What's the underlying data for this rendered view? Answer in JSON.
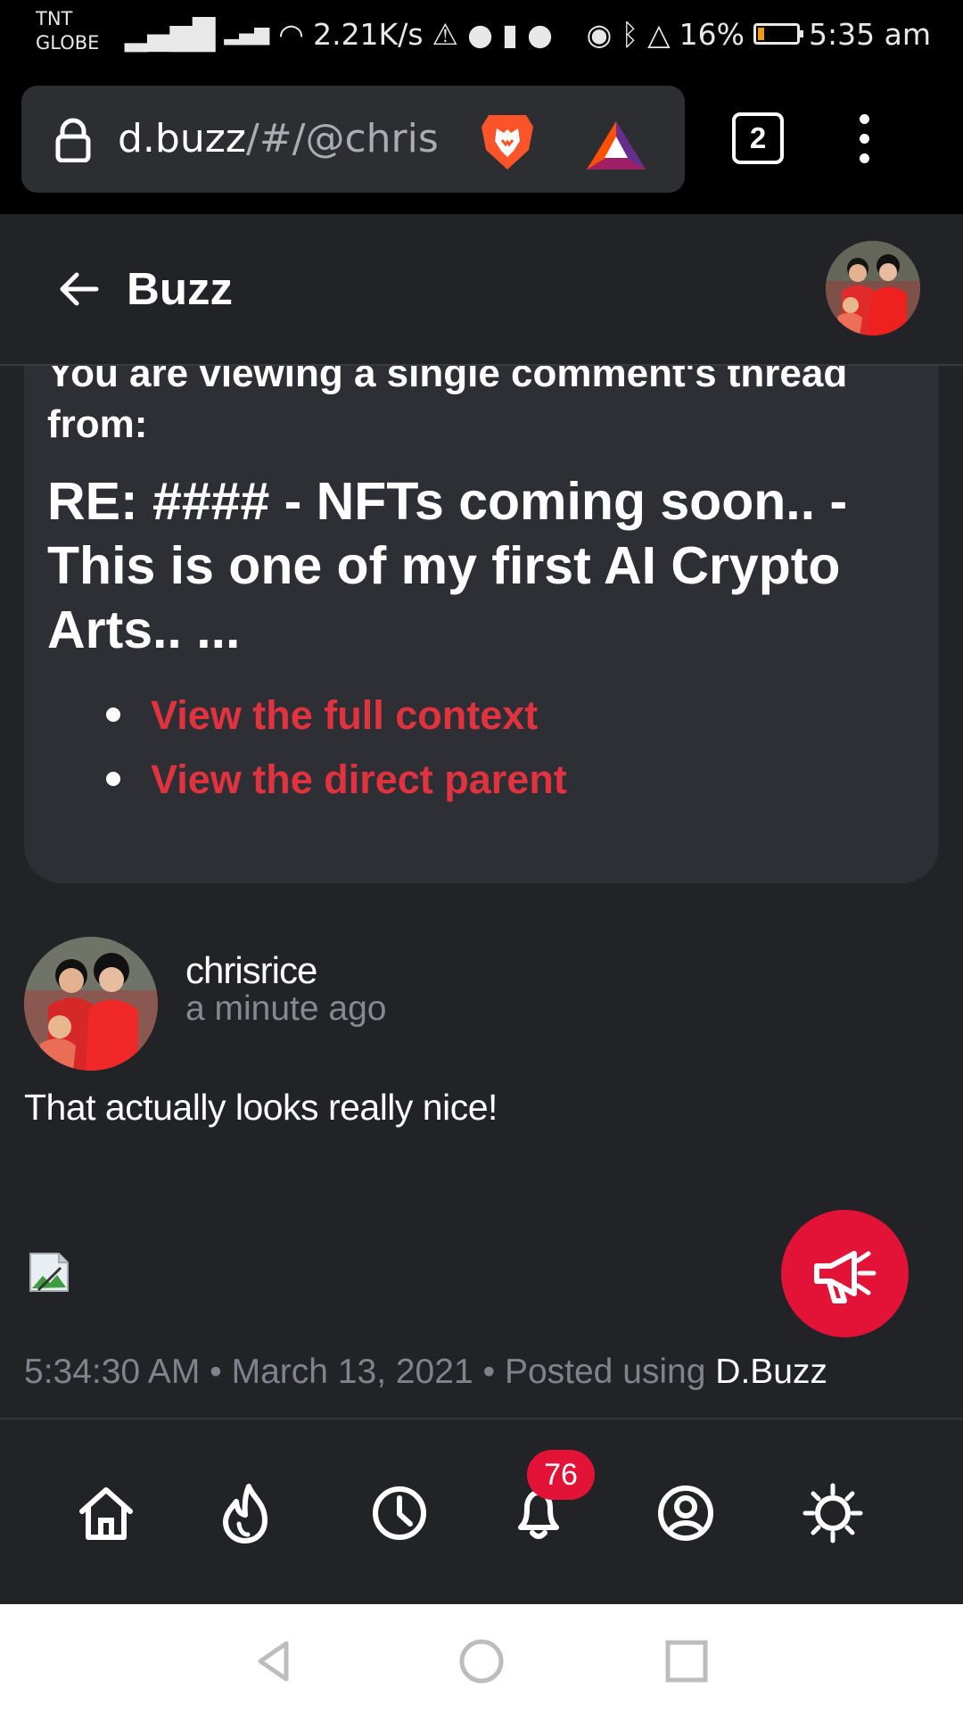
{
  "status_bar": {
    "carrier_line_1": "TNT",
    "carrier_line_2": "GLOBE",
    "network_speed": "2.21K/s",
    "battery_percent": "16%",
    "battery_level": 0.16,
    "time": "5:35 am",
    "battery_fill_color": "#f39b10"
  },
  "browser": {
    "url_primary": "d.buzz",
    "url_secondary": "/#/@chris",
    "tab_count": "2",
    "icons": [
      "lock-icon",
      "brave-lion-icon",
      "basic-attention-token-icon",
      "more-vert-icon"
    ]
  },
  "app": {
    "title": "Buzz",
    "accent": "#e31337"
  },
  "thread_notice": {
    "heading": "You are viewing a single comment's thread from:",
    "post_title": "RE: #### - NFTs coming soon.. - This is one of my first AI Crypto Arts.. ...",
    "links": [
      {
        "label": "View the full context"
      },
      {
        "label": "View the direct parent"
      }
    ]
  },
  "comment": {
    "author": "chrisrice",
    "relative_time": "a minute ago",
    "body": "That actually looks really nice!",
    "footer_time_date": "5:34:30 AM • March 13, 2021 • Posted using ",
    "footer_brand": "D.Buzz"
  },
  "bottom_nav": {
    "items": [
      {
        "name": "home",
        "icon": "home-icon"
      },
      {
        "name": "trending",
        "icon": "flame-icon"
      },
      {
        "name": "latest",
        "icon": "clock-icon"
      },
      {
        "name": "notifications",
        "icon": "bell-icon",
        "badge": "76"
      },
      {
        "name": "profile",
        "icon": "user-circle-icon"
      },
      {
        "name": "theme",
        "icon": "sun-icon"
      }
    ]
  },
  "android_nav": {
    "icons": [
      "back-triangle-icon",
      "home-circle-icon",
      "recents-square-icon"
    ]
  }
}
